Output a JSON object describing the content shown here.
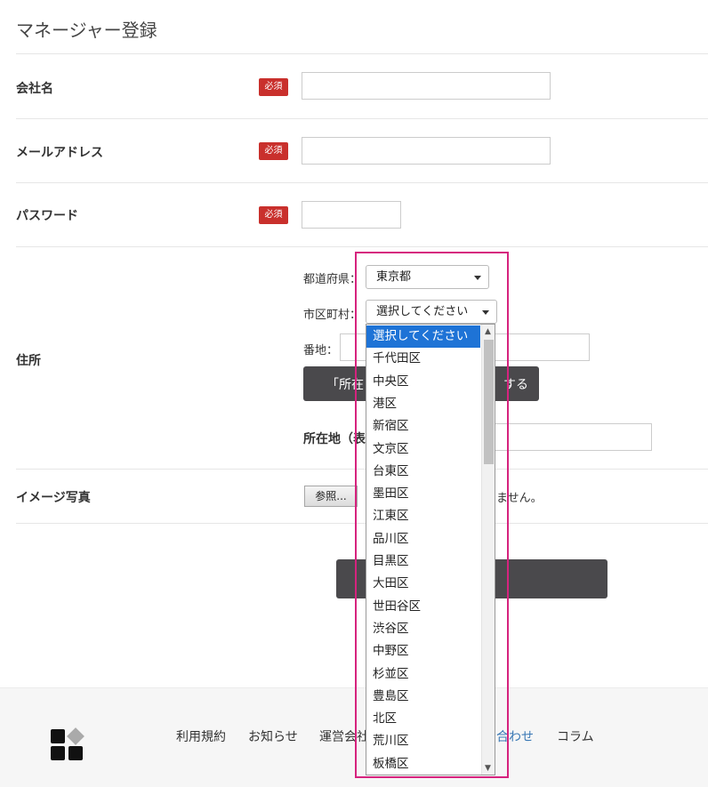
{
  "page": {
    "title": "マネージャー登録"
  },
  "form": {
    "company": {
      "label": "会社名",
      "badge": "必須",
      "value": ""
    },
    "email": {
      "label": "メールアドレス",
      "badge": "必須",
      "value": ""
    },
    "password": {
      "label": "パスワード",
      "badge": "必須",
      "value": ""
    },
    "address": {
      "label": "住所",
      "prefecture_label": "都道府県：",
      "prefecture_value": "東京都",
      "city_label": "市区町村：",
      "city_value": "選択してください",
      "street_label": "番地：",
      "street_value": "",
      "lookup_button_left": "「所在",
      "lookup_button_right": "する",
      "display_label": "所在地（表"
    },
    "image": {
      "label": "イメージ写真",
      "browse_label": "参照...",
      "status_tail": "ません。"
    }
  },
  "city_dropdown": {
    "options": [
      "選択してください",
      "千代田区",
      "中央区",
      "港区",
      "新宿区",
      "文京区",
      "台東区",
      "墨田区",
      "江東区",
      "品川区",
      "目黒区",
      "大田区",
      "世田谷区",
      "渋谷区",
      "中野区",
      "杉並区",
      "豊島区",
      "北区",
      "荒川区",
      "板橋区"
    ],
    "selected_index": 0
  },
  "footer": {
    "links": [
      "利用規約",
      "お知らせ",
      "運営会社",
      "合わせ",
      "コラム"
    ]
  },
  "colors": {
    "required_badge": "#c9302c",
    "dark_button": "#4a494c",
    "selected_option": "#1e73d6",
    "highlight_border": "#d6237e"
  }
}
